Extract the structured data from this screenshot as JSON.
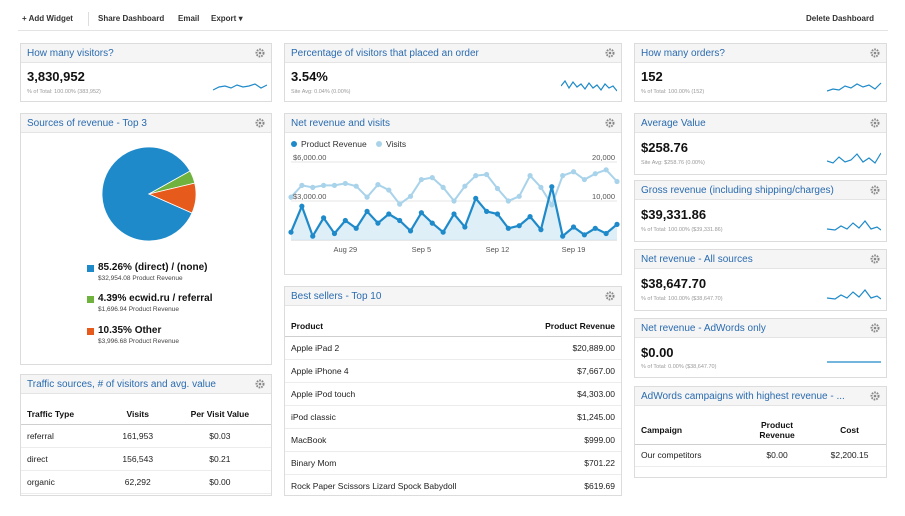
{
  "toolbar": {
    "add_widget": "+ Add Widget",
    "share_dashboard": "Share Dashboard",
    "email": "Email",
    "export": "Export",
    "delete_dashboard": "Delete Dashboard"
  },
  "visitors": {
    "title": "How many visitors?",
    "value": "3,830,952",
    "sub": "% of Total: 100.00% (383,952)"
  },
  "order_pct": {
    "title": "Percentage of visitors that placed an order",
    "value": "3.54%",
    "sub": "Site Avg: 0.04% (0.00%)"
  },
  "orders": {
    "title": "How many orders?",
    "value": "152",
    "sub": "% of Total: 100.00% (152)"
  },
  "revenue_sources": {
    "title": "Sources of revenue - Top 3",
    "items": [
      {
        "label": "85.26% (direct) / (none)",
        "sub": "$32,954.08 Product Revenue",
        "color": "#1f8ac9",
        "pct": 85.26
      },
      {
        "label": "4.39% ecwid.ru / referral",
        "sub": "$1,696.94 Product Revenue",
        "color": "#6fb23d",
        "pct": 4.39
      },
      {
        "label": "10.35% Other",
        "sub": "$3,996.68 Product Revenue",
        "color": "#e65a1c",
        "pct": 10.35
      }
    ]
  },
  "net_revenue_visits": {
    "title": "Net revenue and visits",
    "legend_revenue": "Product Revenue",
    "legend_visits": "Visits",
    "y_left_top": "$6,000.00",
    "y_left_mid": "$3,000.00",
    "y_right_top": "20,000",
    "y_right_mid": "10,000",
    "x_labels": [
      "Aug 29",
      "Sep 5",
      "Sep 12",
      "Sep 19"
    ]
  },
  "chart_data": {
    "type": "line",
    "x": [
      "Aug 24",
      "Aug 25",
      "Aug 26",
      "Aug 27",
      "Aug 28",
      "Aug 29",
      "Aug 30",
      "Aug 31",
      "Sep 1",
      "Sep 2",
      "Sep 3",
      "Sep 4",
      "Sep 5",
      "Sep 6",
      "Sep 7",
      "Sep 8",
      "Sep 9",
      "Sep 10",
      "Sep 11",
      "Sep 12",
      "Sep 13",
      "Sep 14",
      "Sep 15",
      "Sep 16",
      "Sep 17",
      "Sep 18",
      "Sep 19",
      "Sep 20",
      "Sep 21",
      "Sep 22",
      "Sep 23"
    ],
    "series": [
      {
        "name": "Product Revenue",
        "axis": "left",
        "color": "#1f8ac9",
        "values": [
          600,
          2600,
          300,
          1700,
          500,
          1500,
          900,
          2200,
          1300,
          2000,
          1500,
          700,
          2100,
          1300,
          600,
          2000,
          1000,
          3200,
          2200,
          2000,
          900,
          1100,
          1800,
          800,
          4100,
          300,
          1000,
          400,
          900,
          500,
          1200
        ]
      },
      {
        "name": "Visits",
        "axis": "right",
        "color": "#a9d3ea",
        "values": [
          11000,
          14000,
          13500,
          14000,
          14000,
          14500,
          13800,
          11000,
          14200,
          12800,
          9200,
          11200,
          15500,
          16000,
          13500,
          10000,
          13800,
          16500,
          16800,
          13200,
          10000,
          11200,
          16500,
          13500,
          9000,
          16500,
          17500,
          15500,
          17000,
          18000,
          15000
        ]
      }
    ],
    "ylim_left": [
      0,
      6000
    ],
    "ylim_right": [
      0,
      20000
    ]
  },
  "best_sellers": {
    "title": "Best sellers - Top 10",
    "col_product": "Product",
    "col_revenue": "Product Revenue",
    "rows": [
      {
        "product": "Apple iPad 2",
        "revenue": "$20,889.00"
      },
      {
        "product": "Apple iPhone 4",
        "revenue": "$7,667.00"
      },
      {
        "product": "Apple iPod touch",
        "revenue": "$4,303.00"
      },
      {
        "product": "iPod classic",
        "revenue": "$1,245.00"
      },
      {
        "product": "MacBook",
        "revenue": "$999.00"
      },
      {
        "product": "Binary Mom",
        "revenue": "$701.22"
      },
      {
        "product": "Rock Paper Scissors Lizard Spock Babydoll",
        "revenue": "$619.69"
      }
    ]
  },
  "traffic_sources": {
    "title": "Traffic sources, # of visitors and avg. value",
    "col_type": "Traffic Type",
    "col_visits": "Visits",
    "col_value": "Per Visit Value",
    "rows": [
      {
        "type": "referral",
        "visits": "161,953",
        "value": "$0.03"
      },
      {
        "type": "direct",
        "visits": "156,543",
        "value": "$0.21"
      },
      {
        "type": "organic",
        "visits": "62,292",
        "value": "$0.00"
      }
    ]
  },
  "avg_value": {
    "title": "Average Value",
    "value": "$258.76",
    "sub": "Site Avg: $258.76 (0.00%)"
  },
  "gross_revenue": {
    "title": "Gross revenue (including shipping/charges)",
    "value": "$39,331.86",
    "sub": "% of Total: 100.00% ($39,331.86)"
  },
  "net_revenue_all": {
    "title": "Net revenue - All sources",
    "value": "$38,647.70",
    "sub": "% of Total: 100.00% ($38,647.70)"
  },
  "net_revenue_adwords": {
    "title": "Net revenue - AdWords only",
    "value": "$0.00",
    "sub": "% of Total: 0.00% ($38,647.70)"
  },
  "adwords_campaigns": {
    "title": "AdWords campaigns with highest revenue - ...",
    "col_campaign": "Campaign",
    "col_revenue": "Product Revenue",
    "col_cost": "Cost",
    "rows": [
      {
        "campaign": "Our competitors",
        "revenue": "$0.00",
        "cost": "$2,200.15"
      }
    ]
  }
}
